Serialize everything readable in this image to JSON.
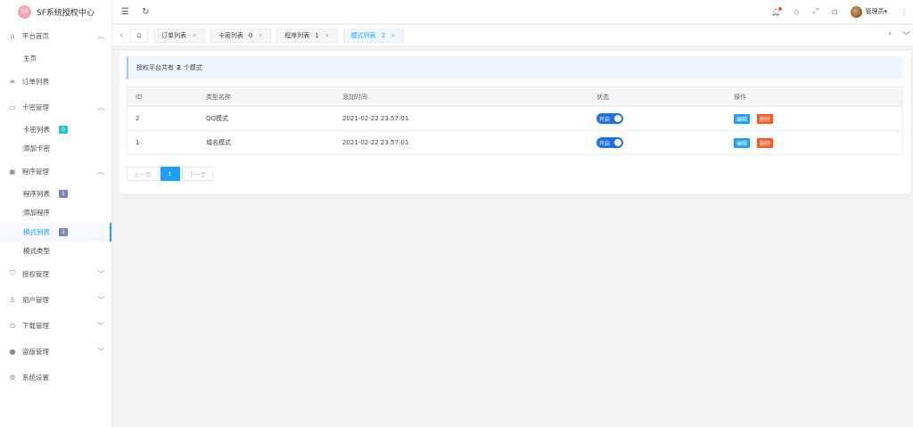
{
  "app": {
    "logo_char": "SF",
    "title": "SF系统授权中心"
  },
  "sidebar": {
    "groups": [
      {
        "label": "平台首页",
        "icon": "home-icon",
        "expanded": true,
        "items": [
          {
            "label": "主页"
          }
        ]
      },
      {
        "label": "订单列表",
        "icon": "list-icon"
      },
      {
        "label": "卡密管理",
        "icon": "card-icon",
        "expanded": true,
        "items": [
          {
            "label": "卡密列表",
            "badge": "0"
          },
          {
            "label": "添加卡密"
          }
        ]
      },
      {
        "label": "程序管理",
        "icon": "program-icon",
        "expanded": true,
        "items": [
          {
            "label": "程序列表",
            "badge": "1"
          },
          {
            "label": "添加程序"
          },
          {
            "label": "模式列表",
            "badge": "2",
            "active": true
          },
          {
            "label": "模式类型"
          }
        ]
      },
      {
        "label": "授权管理",
        "icon": "shield-icon",
        "expanded": false
      },
      {
        "label": "用户管理",
        "icon": "user-icon",
        "expanded": false
      },
      {
        "label": "下载管理",
        "icon": "download-icon",
        "expanded": false
      },
      {
        "label": "盗版管理",
        "icon": "piracy-icon",
        "expanded": false
      },
      {
        "label": "系统设置",
        "icon": "gear-icon"
      }
    ]
  },
  "header": {
    "user_name": "管理员"
  },
  "tabs": [
    {
      "label": "订单列表",
      "count": ""
    },
    {
      "label": "卡密列表",
      "count": "0"
    },
    {
      "label": "程序列表",
      "count": "1"
    },
    {
      "label": "模式列表",
      "count": "2",
      "active": true
    }
  ],
  "notice": {
    "prefix": "授权平台共有",
    "count": "2",
    "suffix": "个模式"
  },
  "table": {
    "headers": [
      "ID",
      "类型名称",
      "添加时间",
      "状态",
      "操作"
    ],
    "rows": [
      {
        "id": "2",
        "name": "QQ模式",
        "time": "2021-02-22 23:57:01",
        "status": "开启"
      },
      {
        "id": "1",
        "name": "域名模式",
        "time": "2021-02-22 23:57:01",
        "status": "开启"
      }
    ],
    "edit_label": "编辑",
    "delete_label": "删除"
  },
  "pager": {
    "prev": "上一页",
    "current": "1",
    "next": "下一页"
  },
  "colors": {
    "accent": "#1e9fff",
    "danger": "#ff5722",
    "switch_on": "#1e6fe8"
  }
}
